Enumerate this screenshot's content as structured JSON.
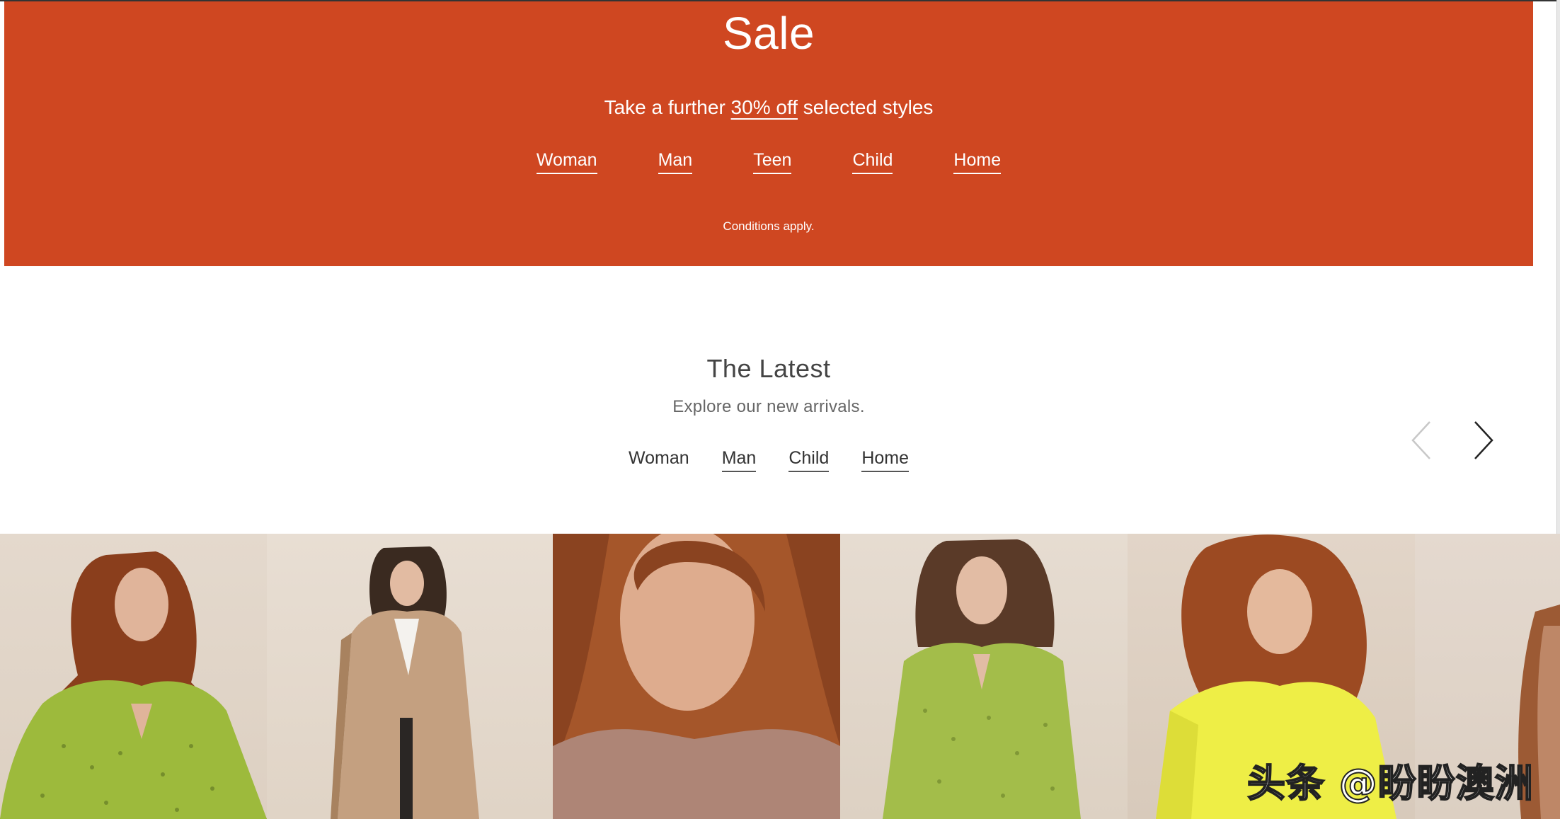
{
  "sale_banner": {
    "title": "Sale",
    "promo_prefix": "Take a further ",
    "promo_highlight": "30% off",
    "promo_suffix": " selected styles",
    "categories": [
      "Woman",
      "Man",
      "Teen",
      "Child",
      "Home"
    ],
    "conditions": "Conditions apply.",
    "background_color": "#cf4721"
  },
  "latest": {
    "title": "The Latest",
    "subtitle": "Explore our new arrivals.",
    "tabs": [
      {
        "label": "Woman",
        "selected": true
      },
      {
        "label": "Man",
        "selected": false
      },
      {
        "label": "Child",
        "selected": false
      },
      {
        "label": "Home",
        "selected": false
      }
    ],
    "carousel": {
      "prev_icon": "chevron-left-icon",
      "next_icon": "chevron-right-icon",
      "prev_enabled": false
    }
  },
  "products": [
    {
      "image": "woman-green-print-blouse"
    },
    {
      "image": "woman-camel-longline-coat"
    },
    {
      "image": "woman-mocha-knit-closeup"
    },
    {
      "image": "woman-green-keyhole-dress"
    },
    {
      "image": "woman-yellow-knit-sweater"
    },
    {
      "image": "woman-partial-next-item"
    }
  ],
  "watermark": "头条 @盼盼澳洲"
}
